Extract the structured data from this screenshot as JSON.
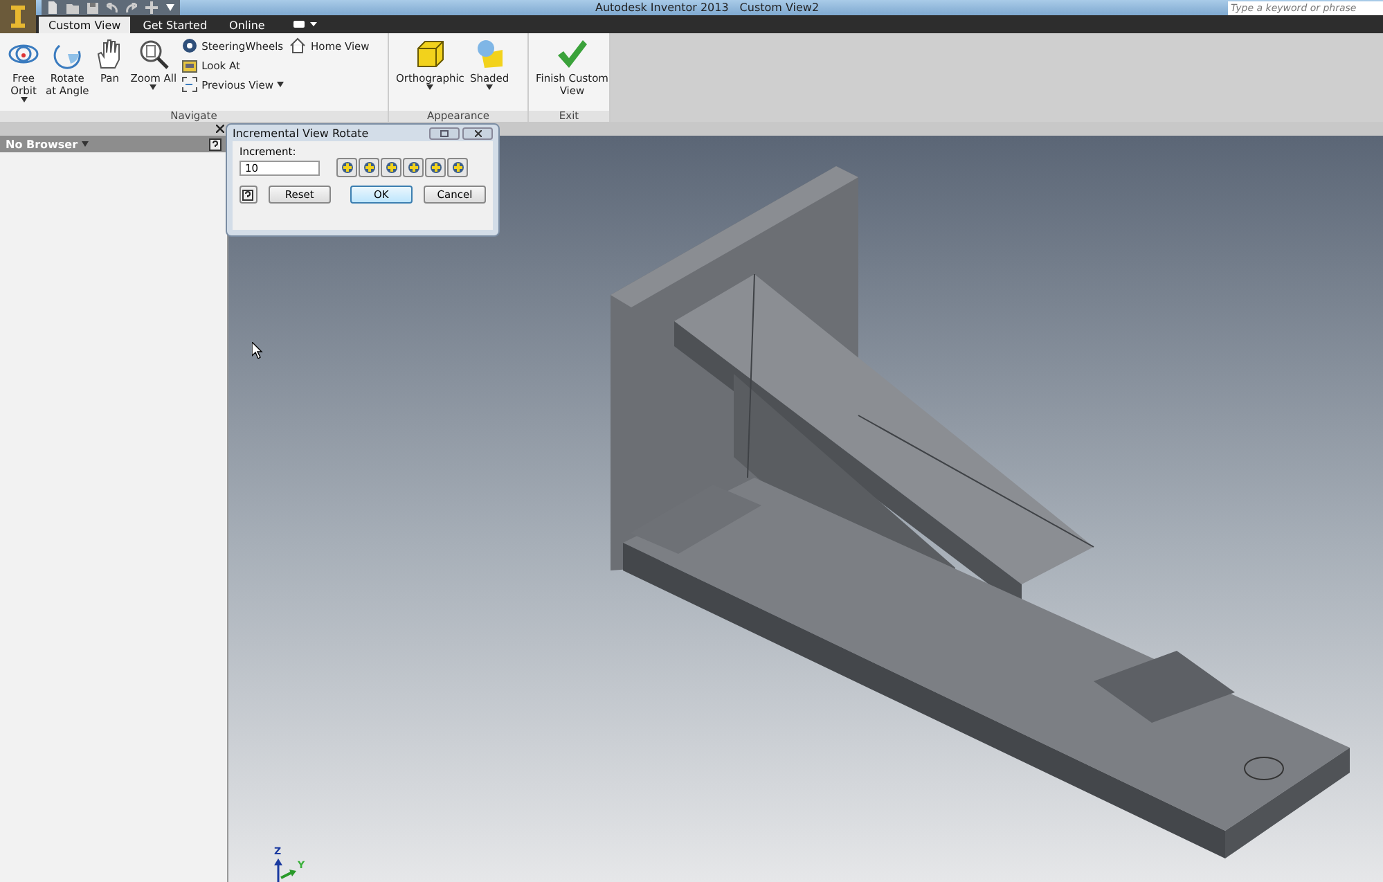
{
  "title_bar": {
    "title": "Autodesk Inventor 2013",
    "document": "Custom View2",
    "search": {
      "placeholder": "Type a keyword or phrase"
    }
  },
  "tabs": [
    {
      "label": "Custom View",
      "selected": true
    },
    {
      "label": "Get Started",
      "selected": false
    },
    {
      "label": "Online",
      "selected": false
    }
  ],
  "ribbon": {
    "panels": [
      {
        "title": "Navigate",
        "tools": [
          {
            "kind": "large",
            "label": "Free\nOrbit",
            "dropdown": true
          },
          {
            "kind": "large",
            "label": "Rotate\nat Angle",
            "dropdown": false
          },
          {
            "kind": "large",
            "label": "Pan",
            "dropdown": false
          },
          {
            "kind": "large",
            "label": "Zoom All",
            "dropdown": true
          },
          {
            "kind": "small",
            "label": "SteeringWheels",
            "dropdown": false
          },
          {
            "kind": "small",
            "label": "Look At",
            "dropdown": false
          },
          {
            "kind": "small",
            "label": "Previous View",
            "dropdown": true
          },
          {
            "kind": "small",
            "label": "Home View",
            "dropdown": false
          }
        ]
      },
      {
        "title": "Appearance",
        "tools": [
          {
            "kind": "large",
            "label": "Orthographic",
            "dropdown": true
          },
          {
            "kind": "large",
            "label": "Shaded",
            "dropdown": true
          }
        ]
      },
      {
        "title": "Exit",
        "tools": [
          {
            "kind": "large",
            "label": "Finish Custom\nView",
            "dropdown": false
          }
        ]
      }
    ]
  },
  "browser": {
    "title": "No Browser"
  },
  "dialog": {
    "title": "Incremental View Rotate",
    "field": {
      "label": "Increment:",
      "value": "10"
    },
    "buttons": [
      {
        "label": "Reset",
        "selected": false
      },
      {
        "label": "OK",
        "selected": true
      },
      {
        "label": "Cancel",
        "selected": false
      }
    ]
  },
  "viewport": {
    "axis_labels": [
      "Z",
      "Y"
    ]
  }
}
